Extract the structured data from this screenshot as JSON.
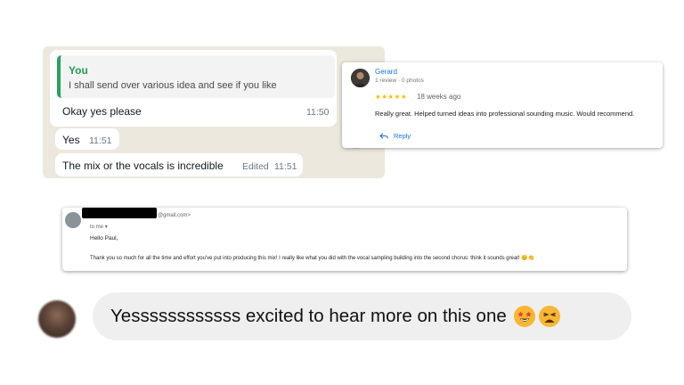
{
  "whatsapp": {
    "quote_name": "You",
    "quote_text": "I shall send over various idea and see if you like",
    "messages": [
      {
        "text": "Okay yes please",
        "time": "11:50",
        "edited": ""
      },
      {
        "text": "Yes",
        "time": "11:51",
        "edited": ""
      },
      {
        "text": "The mix or the vocals is incredible",
        "time": "11:51",
        "edited": "Edited"
      }
    ],
    "react_icon": "smiley-icon"
  },
  "review": {
    "name": "Gerard",
    "meta": "1 review · 0 photos",
    "stars": "★★★★★",
    "rating": 5,
    "when": "18 weeks ago",
    "text": "Really great. Helped turned ideas into professional sounding music. Would recommend.",
    "reply_label": "Reply",
    "colors": {
      "link": "#1a73e8",
      "star": "#fbbc04"
    }
  },
  "email": {
    "from_suffix": "@gmail.com>",
    "to": "to me",
    "greeting": "Hello Paul,",
    "body": "Thank you so much for all the time and effort you've put into producing this mix! I really like what you did with the vocal sampling building into the second chorus: think it sounds great! 😊👏"
  },
  "dm": {
    "text": "Yessssssssssss excited to hear more on this one",
    "emojis": [
      "star-struck-emoji",
      "tired-face-emoji"
    ]
  }
}
